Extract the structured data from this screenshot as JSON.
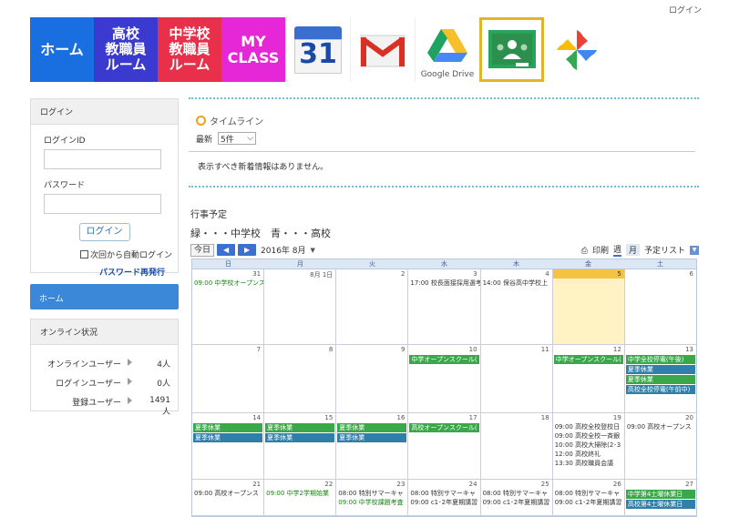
{
  "top_login": "ログイン",
  "nav": {
    "home": "ホーム",
    "hs_line1": "高校",
    "hs_line2": "教職員",
    "hs_line3": "ルーム",
    "ms_line1": "中学校",
    "ms_line2": "教職員",
    "ms_line3": "ルーム",
    "my_line1": "MY",
    "my_line2": "CLASS",
    "calendar_num": "31",
    "drive_label": "Google Drive"
  },
  "login_box": {
    "header": "ログイン",
    "id_label": "ログインID",
    "password_label": "パスワード",
    "login_button": "ログイン",
    "auto_login": "次回から自動ログイン",
    "password_reset": "パスワード再発行"
  },
  "home_menu": "ホーム",
  "online": {
    "header": "オンライン状況",
    "rows": [
      {
        "label": "オンラインユーザー",
        "value": "4人"
      },
      {
        "label": "ログインユーザー",
        "value": "0人"
      },
      {
        "label": "登録ユーザー",
        "value": "1491人"
      }
    ]
  },
  "timeline": {
    "title": "タイムライン",
    "latest_label": "最新",
    "count_option": "5件",
    "empty_message": "表示すべき新着情報はありません。"
  },
  "events": {
    "title": "行事予定",
    "legend": "緑・・・中学校　青・・・高校",
    "today": "今日",
    "month": "2016年 8月",
    "print": "印刷",
    "view_week": "週",
    "view_month": "月",
    "view_list": "予定リスト",
    "dow": [
      "日",
      "月",
      "火",
      "水",
      "木",
      "金",
      "土"
    ],
    "weeks": [
      [
        {
          "num": "31",
          "events": [
            {
              "text": "09:00 中学校オープンス",
              "style": "green-text"
            }
          ]
        },
        {
          "num": "8月 1日",
          "events": []
        },
        {
          "num": "2",
          "events": []
        },
        {
          "num": "3",
          "events": [
            {
              "text": "17:00 校長面接採用選考",
              "style": ""
            }
          ]
        },
        {
          "num": "4",
          "events": [
            {
              "text": "14:00 保谷高中学校上",
              "style": ""
            }
          ]
        },
        {
          "num": "5",
          "events": [],
          "today": true
        },
        {
          "num": "6",
          "events": []
        }
      ],
      [
        {
          "num": "7",
          "events": []
        },
        {
          "num": "8",
          "events": []
        },
        {
          "num": "9",
          "events": []
        },
        {
          "num": "10",
          "events": [
            {
              "text": "中学オープンスクール(",
              "style": "bar-green"
            }
          ]
        },
        {
          "num": "11",
          "events": []
        },
        {
          "num": "12",
          "events": [
            {
              "text": "中学オープンスクール(",
              "style": "bar-green"
            }
          ]
        },
        {
          "num": "13",
          "events": [
            {
              "text": "中学全校停電(午後)",
              "style": "bar-green"
            },
            {
              "text": "夏季休業",
              "style": "bar-blue"
            },
            {
              "text": "夏季休業",
              "style": "bar-green"
            },
            {
              "text": "高校全校停電(午前中)",
              "style": "bar-blue"
            }
          ]
        }
      ],
      [
        {
          "num": "14",
          "events": [
            {
              "text": "夏季休業",
              "style": "bar-green"
            },
            {
              "text": "夏季休業",
              "style": "bar-blue"
            }
          ]
        },
        {
          "num": "15",
          "events": [
            {
              "text": "夏季休業",
              "style": "bar-green"
            },
            {
              "text": "夏季休業",
              "style": "bar-blue"
            }
          ]
        },
        {
          "num": "16",
          "events": [
            {
              "text": "夏季休業",
              "style": "bar-green"
            },
            {
              "text": "夏季休業",
              "style": "bar-blue"
            }
          ]
        },
        {
          "num": "17",
          "events": [
            {
              "text": "高校オープンスクール(",
              "style": "bar-green"
            }
          ]
        },
        {
          "num": "18",
          "events": []
        },
        {
          "num": "19",
          "events": [
            {
              "text": "09:00 高校全校登校日",
              "style": ""
            },
            {
              "text": "09:00 高校全校一斉銀",
              "style": ""
            },
            {
              "text": "10:00 高校大掃除(2･3",
              "style": ""
            },
            {
              "text": "12:00 高校終礼",
              "style": ""
            },
            {
              "text": "13:30 高校職員会議",
              "style": ""
            }
          ]
        },
        {
          "num": "20",
          "events": [
            {
              "text": "09:00 高校オープンス",
              "style": ""
            }
          ]
        }
      ],
      [
        {
          "num": "21",
          "events": [
            {
              "text": "09:00 高校オープンス",
              "style": ""
            }
          ]
        },
        {
          "num": "22",
          "events": [
            {
              "text": "09:00 中学2学期始業",
              "style": "green-text"
            }
          ]
        },
        {
          "num": "23",
          "events": [
            {
              "text": "08:00 特別サマーキャ",
              "style": ""
            },
            {
              "text": "09:00 中学校課題考査",
              "style": "green-text"
            }
          ]
        },
        {
          "num": "24",
          "events": [
            {
              "text": "08:00 特別サマーキャ",
              "style": ""
            },
            {
              "text": "09:00 c1･2年夏期講習",
              "style": ""
            }
          ]
        },
        {
          "num": "25",
          "events": [
            {
              "text": "08:00 特別サマーキャ",
              "style": ""
            },
            {
              "text": "09:00 c1･2年夏期講習",
              "style": ""
            }
          ]
        },
        {
          "num": "26",
          "events": [
            {
              "text": "08:00 特別サマーキャ",
              "style": ""
            },
            {
              "text": "09:00 c1･2年夏期講習",
              "style": ""
            }
          ]
        },
        {
          "num": "27",
          "events": [
            {
              "text": "中学第4土曜休業日",
              "style": "bar-green"
            },
            {
              "text": "高校第4土曜休業日",
              "style": "bar-blue"
            }
          ]
        }
      ]
    ]
  }
}
